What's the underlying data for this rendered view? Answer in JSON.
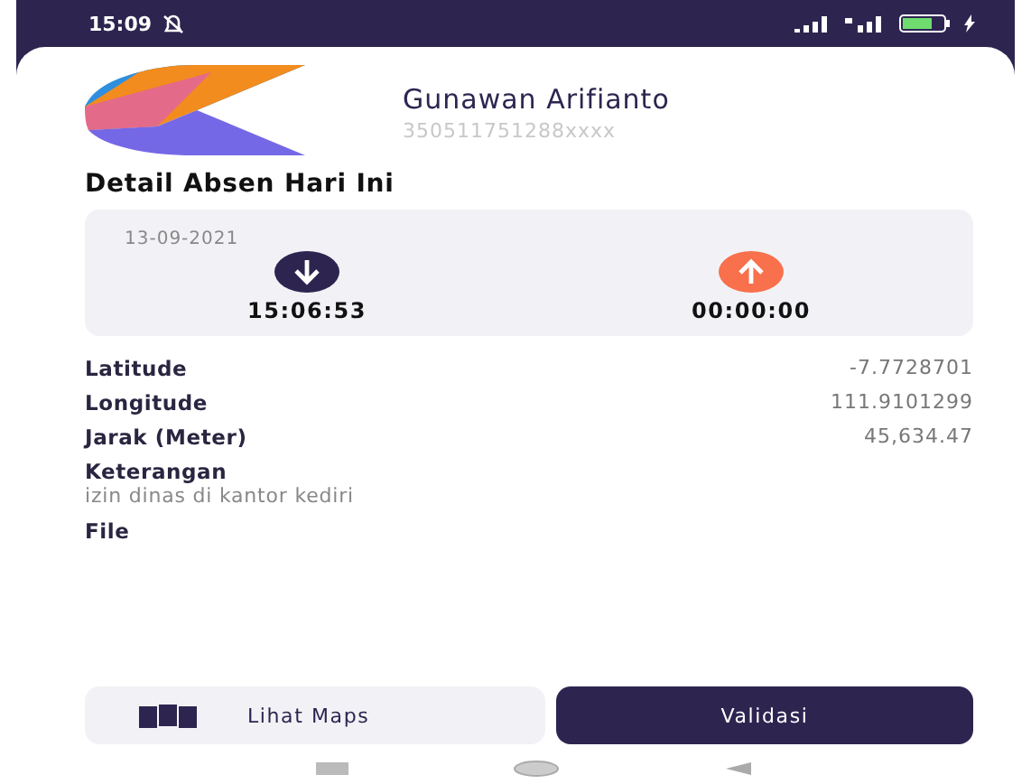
{
  "status_bar": {
    "time": "15:09"
  },
  "profile": {
    "name": "Gunawan Arifianto",
    "id": "350511751288xxxx"
  },
  "section_title": "Detail Absen Hari Ini",
  "attendance": {
    "date": "13-09-2021",
    "check_in": "15:06:53",
    "check_out": "00:00:00"
  },
  "details": [
    {
      "label": "Latitude",
      "value": "-7.7728701"
    },
    {
      "label": "Longitude",
      "value": "111.9101299"
    },
    {
      "label": "Jarak (Meter)",
      "value": "45,634.47"
    }
  ],
  "note": {
    "label": "Keterangan",
    "value": "izin dinas di kantor kediri"
  },
  "file": {
    "label": "File"
  },
  "buttons": {
    "maps": "Lihat Maps",
    "validate": "Validasi"
  }
}
